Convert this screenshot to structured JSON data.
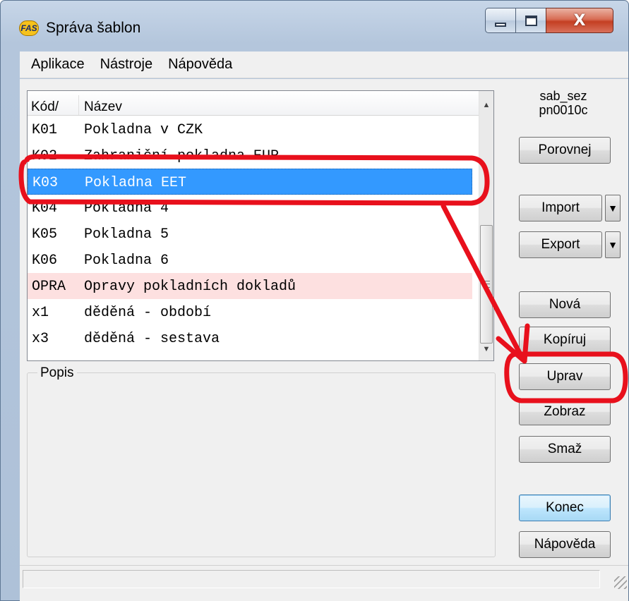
{
  "window": {
    "title": "Správa šablon",
    "app_icon_text": "FAS",
    "close_glyph": "X"
  },
  "menu": [
    "Aplikace",
    "Nástroje",
    "Nápověda"
  ],
  "list": {
    "columns": {
      "code": "Kód/",
      "name": "Název"
    },
    "rows": [
      {
        "code": "K01",
        "name": "Pokladna v CZK",
        "state": "normal"
      },
      {
        "code": "K02",
        "name": "Zahraniční pokladna EUR",
        "state": "normal"
      },
      {
        "code": "K03",
        "name": "Pokladna EET",
        "state": "selected"
      },
      {
        "code": "K04",
        "name": "Pokladna 4",
        "state": "normal"
      },
      {
        "code": "K05",
        "name": "Pokladna 5",
        "state": "normal"
      },
      {
        "code": "K06",
        "name": "Pokladna 6",
        "state": "normal"
      },
      {
        "code": "OPRA",
        "name": "Opravy pokladních dokladů",
        "state": "special"
      },
      {
        "code": "x1",
        "name": "děděná - období",
        "state": "normal"
      },
      {
        "code": "x3",
        "name": "děděná - sestava",
        "state": "normal"
      }
    ]
  },
  "description": {
    "label": "Popis"
  },
  "side": {
    "info_line1": "sab_sez",
    "info_line2": "pn0010c",
    "buttons": {
      "compare": "Porovnej",
      "import": "Import",
      "export": "Export",
      "new": "Nová",
      "copy": "Kopíruj",
      "edit": "Uprav",
      "view": "Zobraz",
      "delete": "Smaž",
      "close": "Konec",
      "help": "Nápověda"
    }
  },
  "colors": {
    "selection": "#3399ff",
    "special_row": "#fde0e0",
    "annotation": "#e8101c"
  }
}
